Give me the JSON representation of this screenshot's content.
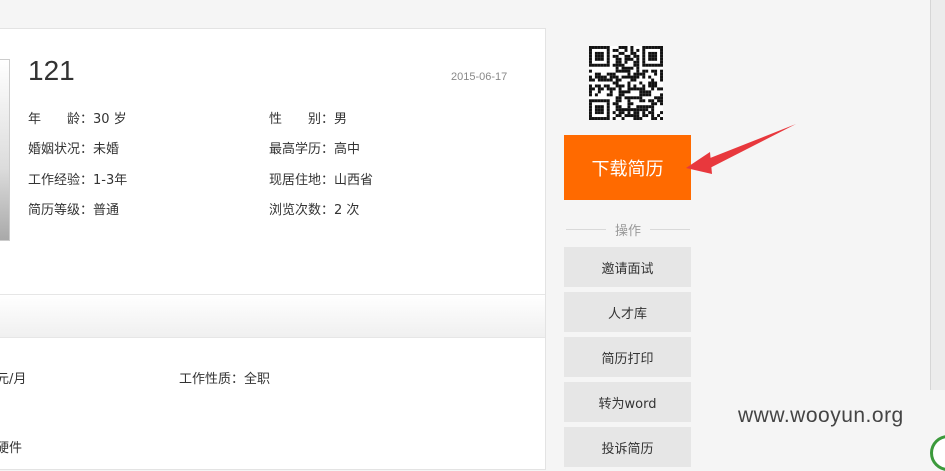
{
  "profile": {
    "name": "121",
    "date": "2015-06-17",
    "fields": [
      {
        "key": "age",
        "text": "年　　龄：30 岁"
      },
      {
        "key": "gender",
        "text": "性　　别：男"
      },
      {
        "key": "marital",
        "text": "婚姻状况：未婚"
      },
      {
        "key": "education",
        "text": "最高学历：高中"
      },
      {
        "key": "experience",
        "text": "工作经验：1-3年"
      },
      {
        "key": "residence",
        "text": "现居住地：山西省"
      },
      {
        "key": "level",
        "text": "简历等级：普通"
      },
      {
        "key": "views",
        "text": "浏览次数：2 次"
      }
    ]
  },
  "lower": {
    "salary_fragment": "元/月",
    "job_nature": "工作性质：全职",
    "bottom_fragment": "硬件"
  },
  "actions": {
    "download_label": "下载简历",
    "section_label": "操作",
    "buttons": [
      "邀请面试",
      "人才库",
      "简历打印",
      "转为word",
      "投诉简历"
    ]
  },
  "watermark": "www.wooyun.org",
  "colors": {
    "accent": "#ff6a00",
    "arrow": "#e8383d"
  }
}
